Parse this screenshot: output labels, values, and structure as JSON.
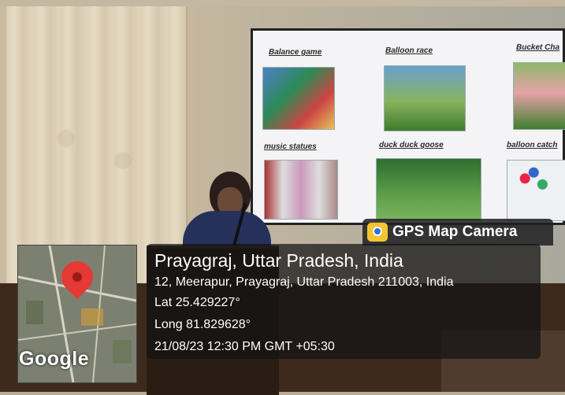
{
  "slide": {
    "items": [
      {
        "label": "Balance game"
      },
      {
        "label": "Balloon race"
      },
      {
        "label": "Bucket Cha"
      },
      {
        "label": "music statues"
      },
      {
        "label": "duck duck goose"
      },
      {
        "label": "balloon catch"
      }
    ]
  },
  "overlay": {
    "app_name": "GPS Map Camera",
    "location_title": "Prayagraj, Uttar Pradesh, India",
    "address": "12, Meerapur, Prayagraj, Uttar Pradesh 211003, India",
    "latitude": "Lat 25.429227°",
    "longitude": "Long 81.829628°",
    "datetime": "21/08/23 12:30 PM GMT +05:30",
    "map_brand": "Google"
  },
  "colors": {
    "pin": "#e53935",
    "overlay_bg": "rgba(18,18,20,0.72)",
    "app_icon": "#f4c431"
  },
  "icons": [
    "map-pin-icon",
    "gps-map-camera-icon"
  ]
}
